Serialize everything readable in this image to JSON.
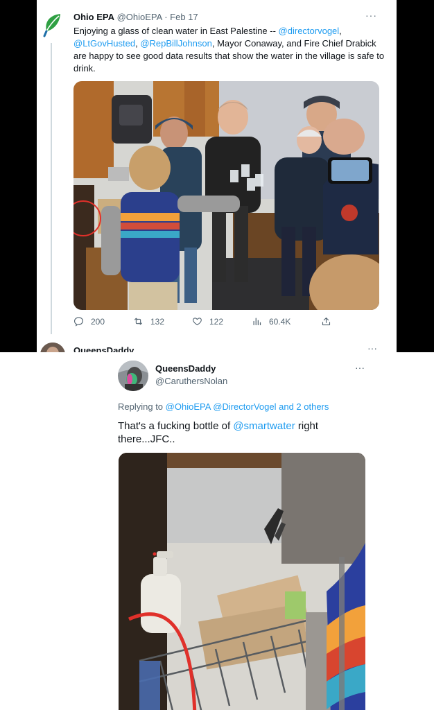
{
  "tweet1": {
    "author_name": "Ohio EPA",
    "author_handle": "@OhioEPA",
    "date": "· Feb 17",
    "more": "···",
    "text_parts": [
      {
        "t": "Enjoying a glass of clean water in East Palestine -- ",
        "m": false
      },
      {
        "t": "@directorvogel",
        "m": true
      },
      {
        "t": ", ",
        "m": false
      },
      {
        "t": "@LtGovHusted",
        "m": true
      },
      {
        "t": ", ",
        "m": false
      },
      {
        "t": "@RepBillJohnson",
        "m": true
      },
      {
        "t": ", Mayor Conaway, and Fire Chief Drabick are happy to see good data results that show the water in the village is safe to drink.",
        "m": false
      }
    ],
    "actions": {
      "replies": "200",
      "retweets": "132",
      "likes": "122",
      "views": "60.4K"
    }
  },
  "tweet2_peek": {
    "author_name": "QueensDaddy",
    "more": "···"
  },
  "reply_tweet": {
    "author_name": "QueensDaddy",
    "author_handle": "@CaruthersNolan",
    "more": "···",
    "replying_prefix": "Replying to ",
    "replying_mentions": "@OhioEPA @DirectorVogel",
    "replying_suffix": " and 2 others",
    "text_before": "That's a fucking bottle of ",
    "text_mention": "@smartwater",
    "text_after": " right there...JFC.."
  },
  "colors": {
    "link": "#1d9bf0",
    "secondary_text": "#536471",
    "highlight_circle": "#e0302a"
  }
}
